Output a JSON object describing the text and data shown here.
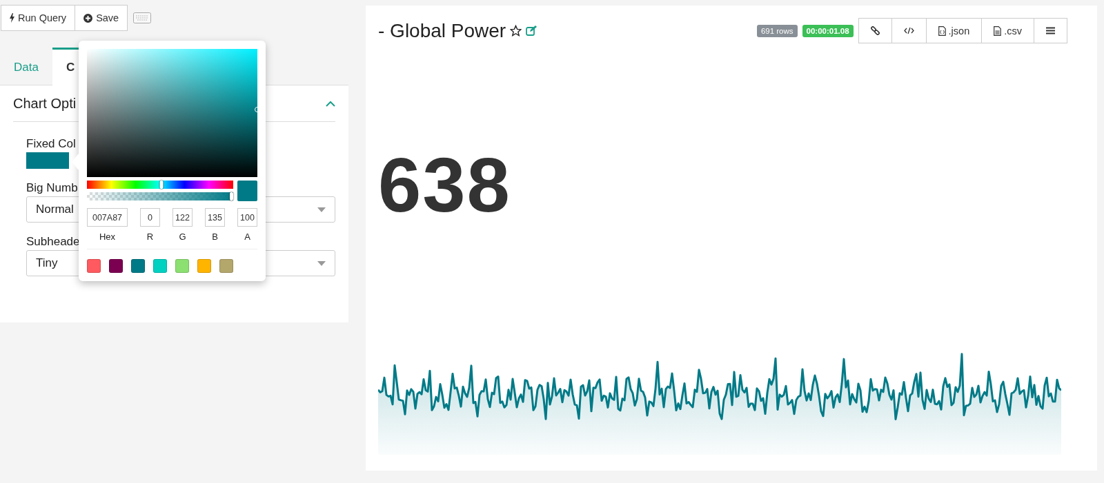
{
  "toolbar": {
    "buttons": [
      {
        "kind": "run",
        "label": "Run Query"
      },
      {
        "kind": "save",
        "label": "Save"
      }
    ]
  },
  "tabs": [
    {
      "label": "Data",
      "selected": false
    },
    {
      "label": "C",
      "selected": true
    }
  ],
  "section": {
    "title": "Chart Opti",
    "expanded": true
  },
  "fields": [
    {
      "kind": "color",
      "label": "Fixed Col"
    },
    {
      "kind": "select",
      "label": "Big Numb",
      "value": "Normal"
    },
    {
      "kind": "select",
      "label": "Subheade",
      "value": "Tiny"
    }
  ],
  "color_picker": {
    "hex": "007A87",
    "r": "0",
    "g": "122",
    "b": "135",
    "a": "100",
    "labels": [
      "Hex",
      "R",
      "G",
      "B",
      "A"
    ],
    "hue": {
      "level": 0.51
    },
    "alpha": {
      "level": 1
    },
    "presets": [
      {
        "color": "#ff5a5f"
      },
      {
        "color": "#7b0051"
      },
      {
        "color": "#007a87"
      },
      {
        "color": "#00d1c1"
      },
      {
        "color": "#8ce071"
      },
      {
        "color": "#ffb400"
      },
      {
        "color": "#b4a76c"
      }
    ]
  },
  "chart": {
    "title": "- Global Power",
    "starred": false,
    "rows": "691 rows",
    "time": "00:00:01.08",
    "actions": [
      {
        "kind": "link"
      },
      {
        "kind": "code"
      },
      {
        "kind": "json",
        "label": ".json"
      },
      {
        "kind": "csv",
        "label": ".csv"
      },
      {
        "kind": "menu"
      }
    ],
    "big_number": "638"
  }
}
